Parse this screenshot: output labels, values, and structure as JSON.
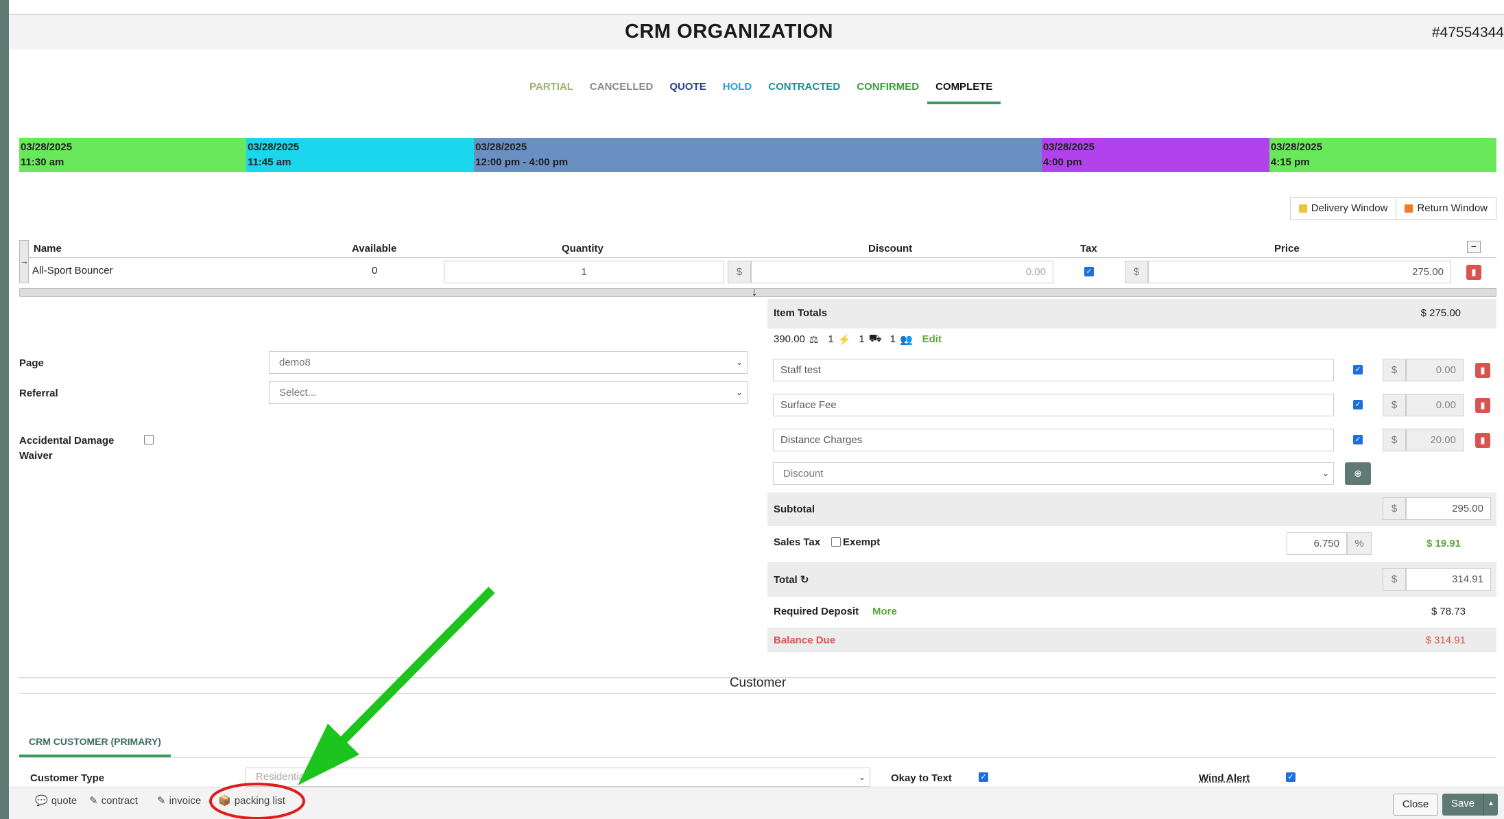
{
  "header": {
    "title": "CRM ORGANIZATION",
    "order_number": "#47554344"
  },
  "status_tabs": [
    {
      "label": "PARTIAL",
      "color": "#9db26b"
    },
    {
      "label": "CANCELLED",
      "color": "#888888"
    },
    {
      "label": "QUOTE",
      "color": "#27408b"
    },
    {
      "label": "HOLD",
      "color": "#2b9ad6"
    },
    {
      "label": "CONTRACTED",
      "color": "#1a8f8f"
    },
    {
      "label": "CONFIRMED",
      "color": "#3c9a3c"
    },
    {
      "label": "COMPLETE",
      "color": "#111111",
      "active": true
    }
  ],
  "timeline": [
    {
      "date": "03/28/2025",
      "time": "11:30 am",
      "color": "#6ae85b"
    },
    {
      "date": "03/28/2025",
      "time": "11:45 am",
      "color": "#1ad7ee"
    },
    {
      "date": "03/28/2025",
      "time": "12:00 pm - 4:00 pm",
      "color": "#6a8fc2"
    },
    {
      "date": "03/28/2025",
      "time": "4:00 pm",
      "color": "#b243ec"
    },
    {
      "date": "03/28/2025",
      "time": "4:15 pm",
      "color": "#6ae85b"
    }
  ],
  "windows": {
    "delivery": "Delivery Window",
    "delivery_color": "#e8c53c",
    "return": "Return Window",
    "return_color": "#f07b2a"
  },
  "items_table": {
    "headers": {
      "name": "Name",
      "available": "Available",
      "quantity": "Quantity",
      "discount": "Discount",
      "tax": "Tax",
      "price": "Price"
    },
    "rows": [
      {
        "name": "All-Sport Bouncer",
        "available": "0",
        "quantity": "1",
        "discount_symbol": "$",
        "discount": "0.00",
        "tax": true,
        "price_symbol": "$",
        "price": "275.00"
      }
    ]
  },
  "form": {
    "page_label": "Page",
    "page_value": "demo8",
    "referral_label": "Referral",
    "referral_value": "Select...",
    "adw_label_line1": "Accidental Damage",
    "adw_label_line2": "Waiver"
  },
  "totals": {
    "item_totals_label": "Item Totals",
    "item_totals_value": "$ 275.00",
    "meta_weight": "390.00",
    "meta_a": "1",
    "meta_b": "1",
    "meta_c": "1",
    "edit_label": "Edit",
    "fees": [
      {
        "name": "Staff test",
        "symbol": "$",
        "value": "0.00"
      },
      {
        "name": "Surface Fee",
        "symbol": "$",
        "value": "0.00"
      },
      {
        "name": "Distance Charges",
        "symbol": "$",
        "value": "20.00"
      }
    ],
    "discount_select": "Discount",
    "subtotal_label": "Subtotal",
    "subtotal_symbol": "$",
    "subtotal_value": "295.00",
    "sales_tax_label": "Sales Tax",
    "exempt_label": "Exempt",
    "tax_rate": "6.750",
    "tax_pct": "%",
    "tax_value": "$ 19.91",
    "total_label": "Total",
    "total_symbol": "$",
    "total_value": "314.91",
    "deposit_label": "Required Deposit",
    "more_label": "More",
    "deposit_value": "$ 78.73",
    "balance_label": "Balance Due",
    "balance_value": "$ 314.91"
  },
  "customer": {
    "heading": "Customer",
    "tab_label": "CRM CUSTOMER (PRIMARY)",
    "type_label": "Customer Type",
    "type_value": "Residential",
    "okay_text_label": "Okay to Text",
    "wind_alert_label": "Wind Alert"
  },
  "footer": {
    "quote": "quote",
    "contract": "contract",
    "invoice": "invoice",
    "packing_list": "packing list",
    "close": "Close",
    "save": "Save"
  }
}
